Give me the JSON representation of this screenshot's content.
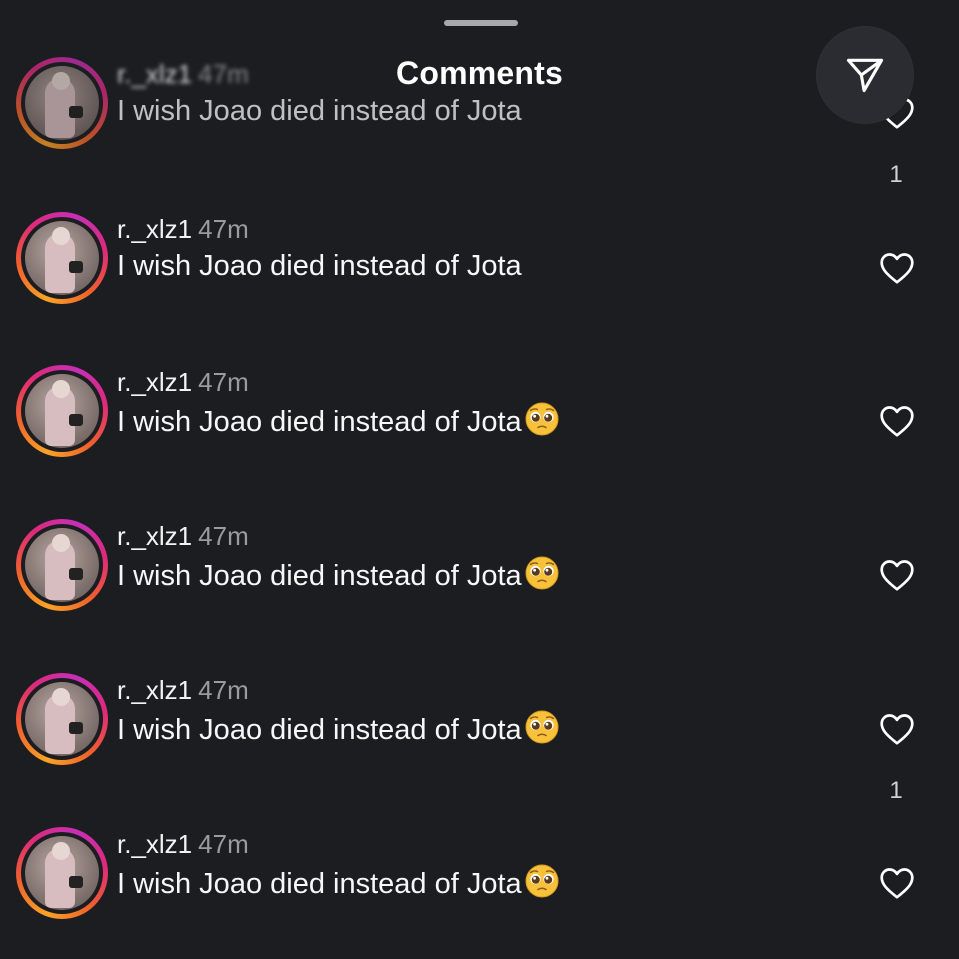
{
  "header": {
    "title": "Comments"
  },
  "comments": [
    {
      "username": "r._xlz1",
      "time": "47m",
      "text": "I wish Joao died instead of Jota",
      "emoji": "",
      "like_count": "1"
    },
    {
      "username": "r._xlz1",
      "time": "47m",
      "text": "I wish Joao died instead of Jota",
      "emoji": "",
      "like_count": ""
    },
    {
      "username": "r._xlz1",
      "time": "47m",
      "text": "I wish Joao died instead of Jota",
      "emoji": "pleading-face-emoji",
      "like_count": ""
    },
    {
      "username": "r._xlz1",
      "time": "47m",
      "text": "I wish Joao died instead of Jota",
      "emoji": "pleading-face-emoji",
      "like_count": ""
    },
    {
      "username": "r._xlz1",
      "time": "47m",
      "text": "I wish Joao died instead of Jota",
      "emoji": "pleading-face-emoji",
      "like_count": "1"
    },
    {
      "username": "r._xlz1",
      "time": "47m",
      "text": "I wish Joao died instead of Jota",
      "emoji": "pleading-face-emoji",
      "like_count": ""
    }
  ],
  "icons": {
    "share": "send-icon",
    "like": "heart-outline-icon"
  },
  "colors": {
    "background": "#1c1d21",
    "ring_start": "#f9a325",
    "ring_mid": "#dd2a7b",
    "ring_end": "#c72fb8",
    "timestamp": "#9a9ba0"
  }
}
